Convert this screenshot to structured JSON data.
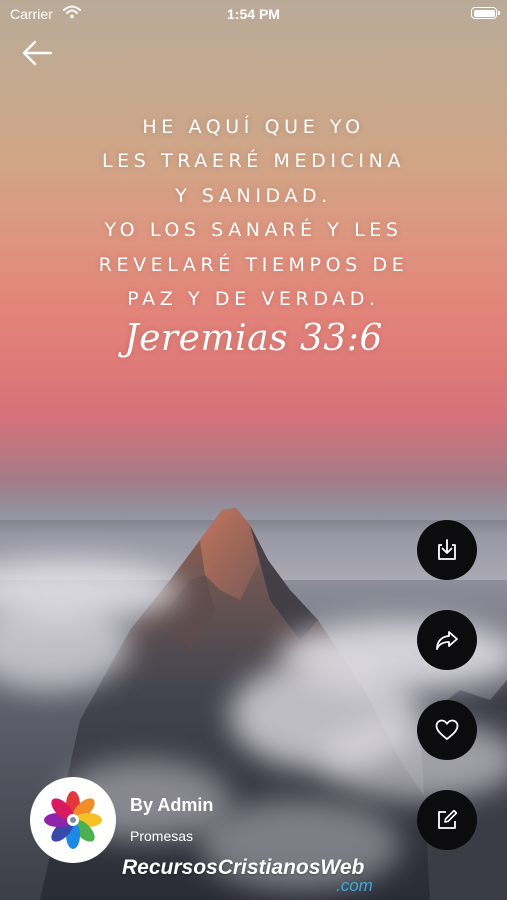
{
  "status_bar": {
    "carrier": "Carrier",
    "time": "1:54 PM"
  },
  "verse": {
    "lines": [
      "HE AQUÍ QUE YO",
      "LES TRAERÉ MEDICINA",
      "Y SANIDAD.",
      "YO LOS SANARÉ Y LES",
      "REVELARÉ TIEMPOS DE",
      "PAZ Y DE VERDAD."
    ],
    "reference": "Jeremias 33:6"
  },
  "actions": [
    {
      "name": "download",
      "icon": "download-icon"
    },
    {
      "name": "share",
      "icon": "share-icon"
    },
    {
      "name": "favorite",
      "icon": "heart-icon"
    },
    {
      "name": "edit",
      "icon": "edit-icon"
    }
  ],
  "author": {
    "name": "By Admin",
    "category": "Promesas"
  },
  "watermark": {
    "main": "RecursosCristianosWeb",
    "sub": ".com"
  },
  "colors": {
    "button_bg": "#0c0c0e",
    "watermark_accent": "#3ca7e0"
  }
}
